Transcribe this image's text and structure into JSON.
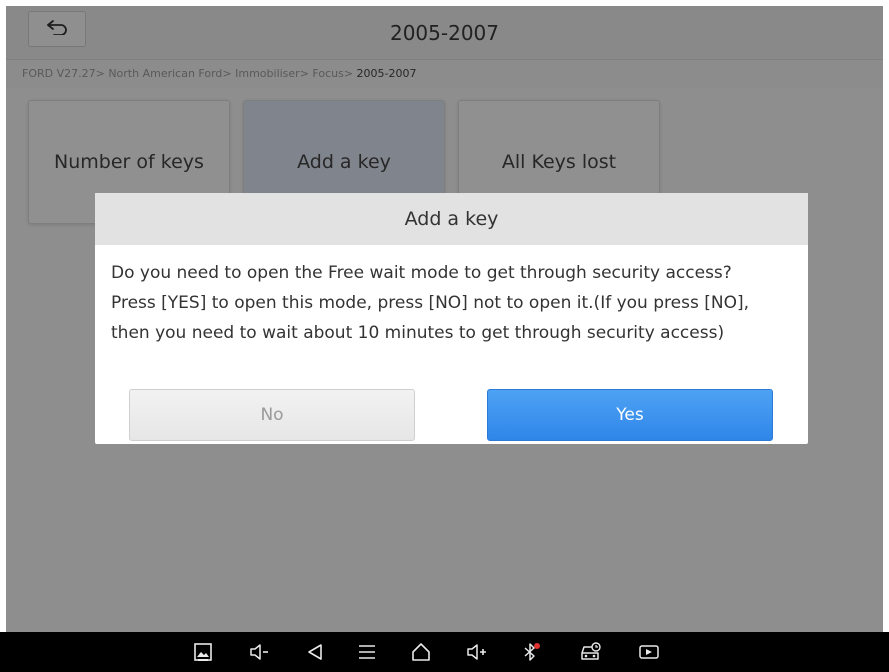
{
  "header": {
    "title": "2005-2007"
  },
  "breadcrumb": {
    "path": "FORD V27.27> North American Ford> Immobiliser> Focus> ",
    "current": "2005-2007"
  },
  "tiles": [
    {
      "label": "Number of keys"
    },
    {
      "label": "Add a key"
    },
    {
      "label": "All Keys lost"
    }
  ],
  "dialog": {
    "title": "Add a key",
    "lines": [
      "Do you need to open the Free wait mode to get through security access?",
      "Press [YES] to open this mode, press [NO] not to open it.(If you press [NO],",
      "then you need to wait about 10 minutes to get through security access)"
    ],
    "no_label": "No",
    "yes_label": "Yes"
  },
  "navbar": {
    "icons": [
      "screenshot-icon",
      "volume-down-icon",
      "back-icon",
      "menu-icon",
      "home-icon",
      "volume-up-icon",
      "bluetooth-icon",
      "vehicle-diagnostic-icon",
      "screen-record-icon"
    ]
  },
  "colors": {
    "accent": "#2f86e8",
    "overlay": "#000000",
    "navbar": "#000000"
  }
}
